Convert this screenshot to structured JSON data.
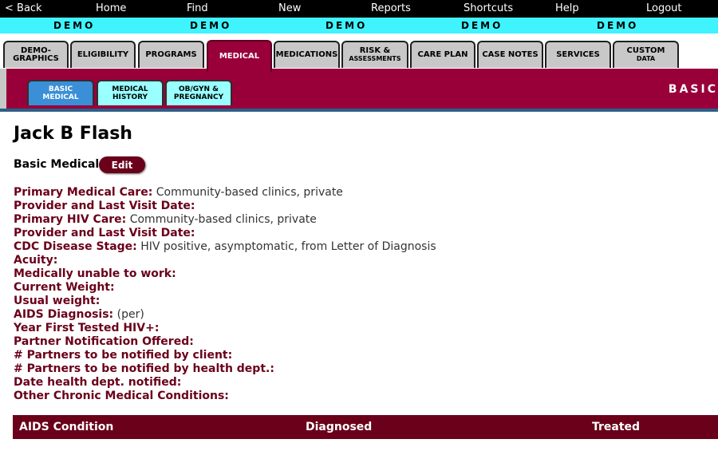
{
  "topnav": {
    "items": [
      "< Back",
      "Home",
      "Find",
      "New",
      "Reports",
      "Shortcuts",
      "Help",
      "Logout"
    ]
  },
  "demo_bar": {
    "labels": [
      "DEMO",
      "DEMO",
      "DEMO",
      "DEMO",
      "DEMO"
    ]
  },
  "main_tabs": [
    {
      "label": "DEMO-\nGRAPHICS",
      "active": false
    },
    {
      "label": "ELIGIBILITY",
      "active": false
    },
    {
      "label": "PROGRAMS",
      "active": false
    },
    {
      "label": "MEDICAL",
      "active": true
    },
    {
      "label": "MEDICATIONS",
      "active": false
    },
    {
      "label": "RISK &",
      "sub": "ASSESSMENTS",
      "active": false
    },
    {
      "label": "CARE PLAN",
      "active": false
    },
    {
      "label": "CASE NOTES",
      "active": false
    },
    {
      "label": "SERVICES",
      "active": false
    },
    {
      "label": "CUSTOM",
      "sub": "DATA",
      "active": false
    }
  ],
  "sub_tabs": [
    {
      "label": "BASIC\nMEDICAL",
      "active": true
    },
    {
      "label": "MEDICAL\nHISTORY",
      "active": false
    },
    {
      "label": "OB/GYN &\nPREGNANCY",
      "active": false
    }
  ],
  "sub_title": "BASIC",
  "client_name": "Jack B Flash",
  "section": {
    "title": "Basic Medical",
    "edit_label": "Edit"
  },
  "fields": [
    {
      "label": "Primary Medical Care:",
      "value": "Community-based clinics, private"
    },
    {
      "label": "Provider and Last Visit Date:",
      "value": ""
    },
    {
      "label": "Primary HIV Care:",
      "value": "Community-based clinics, private"
    },
    {
      "label": "Provider and Last Visit Date:",
      "value": ""
    },
    {
      "label": "CDC Disease Stage:",
      "value": "HIV positive, asymptomatic, from Letter of Diagnosis"
    },
    {
      "label": "Acuity:",
      "value": ""
    },
    {
      "label": "Medically unable to work:",
      "value": ""
    },
    {
      "label": "Current Weight:",
      "value": ""
    },
    {
      "label": "Usual weight:",
      "value": ""
    },
    {
      "label": "AIDS Diagnosis:",
      "value": "(per)"
    },
    {
      "label": "Year First Tested HIV+:",
      "value": ""
    },
    {
      "label": "Partner Notification Offered:",
      "value": ""
    },
    {
      "label": "# Partners to be notified by client:",
      "value": ""
    },
    {
      "label": "# Partners to be notified by health dept.:",
      "value": ""
    },
    {
      "label": "Date health dept. notified:",
      "value": ""
    },
    {
      "label": "Other Chronic Medical Conditions:",
      "value": ""
    }
  ],
  "table": {
    "headers": [
      "AIDS Condition",
      "Diagnosed",
      "Treated"
    ]
  },
  "colors": {
    "accent": "#99003a",
    "label": "#6a0019",
    "demo_bar": "#3ff3ff",
    "subtab_active": "#3b8fd6",
    "subtab_inactive": "#99ffff"
  }
}
